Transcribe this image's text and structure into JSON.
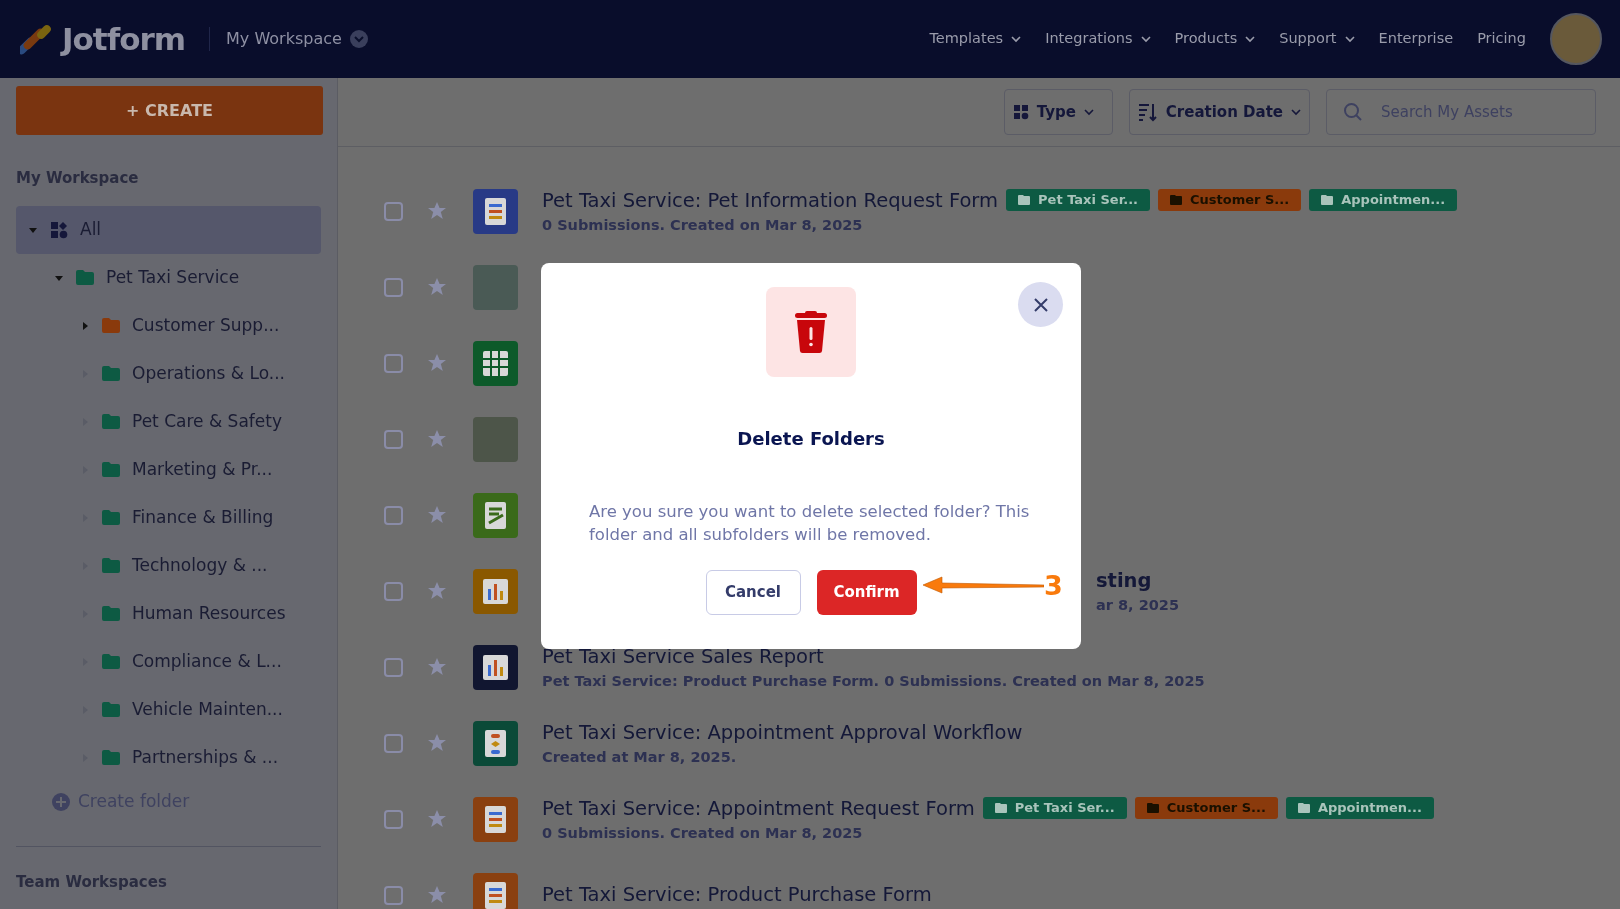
{
  "header": {
    "logo": "Jotform",
    "workspace": "My Workspace",
    "nav": [
      {
        "label": "Templates",
        "dropdown": true
      },
      {
        "label": "Integrations",
        "dropdown": true
      },
      {
        "label": "Products",
        "dropdown": true
      },
      {
        "label": "Support",
        "dropdown": true
      },
      {
        "label": "Enterprise",
        "dropdown": false
      },
      {
        "label": "Pricing",
        "dropdown": false
      }
    ]
  },
  "create_button": "+ CREATE",
  "toolbar": {
    "type_filter": "Type",
    "sort": "Creation Date",
    "search": {
      "placeholder": "Search My Assets"
    }
  },
  "sidebar": {
    "heading": "My Workspace",
    "tree": [
      {
        "label": "All",
        "kind": "all",
        "selected": true,
        "expanded": true,
        "children": [
          {
            "label": "Pet Taxi Service",
            "kind": "folder",
            "color": "#0d5a43",
            "selected": false,
            "expanded": true,
            "children": [
              {
                "label": "Customer Supp...",
                "kind": "folder",
                "color": "#8a3a0c",
                "selected": false,
                "expanded": false,
                "expandable": true
              },
              {
                "label": "Operations & Lo...",
                "kind": "folder",
                "color": "#0d5a43",
                "selected": false,
                "expanded": false,
                "expandable": false
              },
              {
                "label": "Pet Care & Safety",
                "kind": "folder",
                "color": "#0d5a43",
                "selected": false,
                "expanded": false,
                "expandable": false
              },
              {
                "label": "Marketing & Pr...",
                "kind": "folder",
                "color": "#0d5a43",
                "selected": false,
                "expanded": false,
                "expandable": false
              },
              {
                "label": "Finance & Billing",
                "kind": "folder",
                "color": "#0d5a43",
                "selected": false,
                "expanded": false,
                "expandable": false
              },
              {
                "label": "Technology & ...",
                "kind": "folder",
                "color": "#0d5a43",
                "selected": false,
                "expanded": false,
                "expandable": false
              },
              {
                "label": "Human Resources",
                "kind": "folder",
                "color": "#0d5a43",
                "selected": false,
                "expanded": false,
                "expandable": false
              },
              {
                "label": "Compliance & L...",
                "kind": "folder",
                "color": "#0d5a43",
                "selected": false,
                "expanded": false,
                "expandable": false
              },
              {
                "label": "Vehicle Mainten...",
                "kind": "folder",
                "color": "#0d5a43",
                "selected": false,
                "expanded": false,
                "expandable": false
              },
              {
                "label": "Partnerships & ...",
                "kind": "folder",
                "color": "#0d5a43",
                "selected": false,
                "expanded": false,
                "expandable": false
              }
            ]
          }
        ]
      }
    ],
    "create_folder": "Create folder",
    "team_heading": "Team Workspaces"
  },
  "assets": [
    {
      "kind": "form",
      "color": "#283a86",
      "checked": false,
      "starred": false,
      "title": "Pet Taxi Service: Pet Information Request Form",
      "subtitle": "0 Submissions. Created on Mar 8, 2025",
      "tags": [
        {
          "label": "Pet Taxi Ser...",
          "color": "#0d5a43"
        },
        {
          "label": "Customer S...",
          "color": "#8a3a0c"
        },
        {
          "label": "Appointmen...",
          "color": "#0d5a43"
        }
      ]
    },
    {
      "kind": "photo",
      "color": "#4a5a55",
      "checked": false,
      "starred": false
    },
    {
      "kind": "table",
      "color": "#0d5a2a",
      "checked": false,
      "starred": false
    },
    {
      "kind": "photo",
      "color": "#4d5549",
      "checked": false,
      "starred": false
    },
    {
      "kind": "sign",
      "color": "#3a6a1a",
      "checked": false,
      "starred": false
    },
    {
      "kind": "report",
      "color": "#8a5800",
      "checked": false,
      "starred": false,
      "title": "sting",
      "subtitle": "ar 8, 2025",
      "covered": true
    },
    {
      "kind": "report",
      "color": "#111630",
      "checked": false,
      "starred": false,
      "title": "Pet Taxi Service Sales Report",
      "subtitle": "Pet Taxi Service: Product Purchase Form. 0 Submissions. Created on Mar 8, 2025"
    },
    {
      "kind": "workflow",
      "color": "#0b4a38",
      "checked": false,
      "starred": false,
      "title": "Pet Taxi Service: Appointment Approval Workflow",
      "subtitle": "Created at Mar 8, 2025."
    },
    {
      "kind": "form",
      "color": "#8a4010",
      "checked": false,
      "starred": false,
      "title": "Pet Taxi Service: Appointment Request Form",
      "subtitle": "0 Submissions. Created on Mar 8, 2025",
      "tags": [
        {
          "label": "Pet Taxi Ser...",
          "color": "#0d5a43"
        },
        {
          "label": "Customer S...",
          "color": "#8a3a0c"
        },
        {
          "label": "Appointmen...",
          "color": "#0d5a43"
        }
      ]
    },
    {
      "kind": "form",
      "color": "#8a4010",
      "checked": false,
      "starred": false,
      "title": "Pet Taxi Service: Product Purchase Form"
    }
  ],
  "dialog": {
    "title": "Delete Folders",
    "message": "Are you sure you want to delete selected folder? This folder and all subfolders will be removed.",
    "buttons": [
      {
        "label": "Cancel",
        "kind": "secondary"
      },
      {
        "label": "Confirm",
        "kind": "danger"
      }
    ]
  },
  "annotation": {
    "label": "3"
  }
}
